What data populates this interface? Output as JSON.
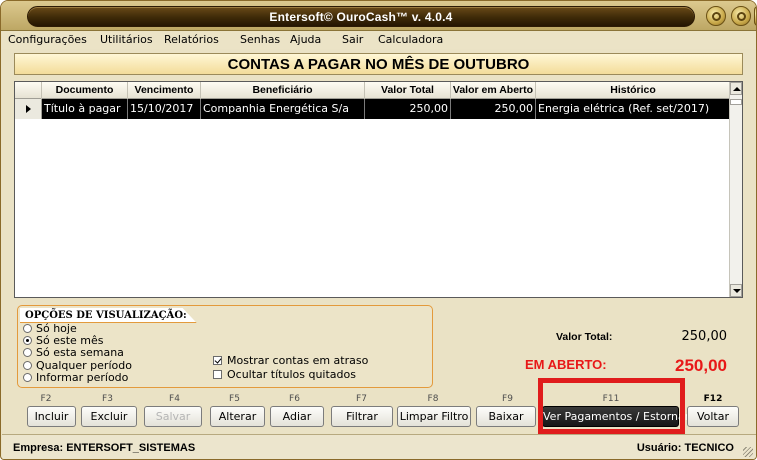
{
  "window": {
    "title": "Entersoft© OuroCash™ v. 4.0.4"
  },
  "menu": [
    "Configurações",
    "Utilitários",
    "Relatórios",
    "Senhas",
    "Ajuda",
    "Sair",
    "Calculadora"
  ],
  "page_title": "CONTAS A PAGAR NO MÊS DE OUTUBRO",
  "grid": {
    "columns": [
      "Documento",
      "Vencimento",
      "Beneficiário",
      "Valor Total",
      "Valor em Aberto",
      "Histórico"
    ],
    "rows": [
      {
        "documento": "Título à pagar",
        "vencimento": "15/10/2017",
        "beneficiario": "Companhia Energética S/a",
        "valor_total": "250,00",
        "valor_aberto": "250,00",
        "historico": "Energia elétrica (Ref. set/2017)"
      }
    ]
  },
  "options": {
    "title": "OPÇÕES DE VISUALIZAÇÃO:",
    "radios": [
      {
        "label": "Só hoje",
        "selected": false
      },
      {
        "label": "Só este mês",
        "selected": true
      },
      {
        "label": "Só esta semana",
        "selected": false
      },
      {
        "label": "Qualquer período",
        "selected": false
      },
      {
        "label": "Informar período",
        "selected": false
      }
    ],
    "checks": [
      {
        "label": "Mostrar contas em atraso",
        "checked": true
      },
      {
        "label": "Ocultar títulos quitados",
        "checked": false
      }
    ]
  },
  "totals": {
    "total_label": "Valor Total:",
    "total_value": "250,00",
    "open_label": "EM ABERTO:",
    "open_value": "250,00"
  },
  "buttons": [
    {
      "key": "F2",
      "label": "Incluir",
      "enabled": true
    },
    {
      "key": "F3",
      "label": "Excluir",
      "enabled": true
    },
    {
      "key": "F4",
      "label": "Salvar",
      "enabled": false
    },
    {
      "key": "F5",
      "label": "Alterar",
      "enabled": true
    },
    {
      "key": "F6",
      "label": "Adiar",
      "enabled": true
    },
    {
      "key": "F7",
      "label": "Filtrar",
      "enabled": true
    },
    {
      "key": "F8",
      "label": "Limpar Filtro",
      "enabled": true
    },
    {
      "key": "F9",
      "label": "Baixar",
      "enabled": true
    },
    {
      "key": "F11",
      "label": "Ver Pagamentos / Estornar",
      "enabled": true
    },
    {
      "key": "F12",
      "label": "Voltar",
      "enabled": true
    }
  ],
  "status": {
    "company": "Empresa: ENTERSOFT_SISTEMAS",
    "user": "Usuário: TECNICO"
  },
  "colors": {
    "accent_red": "#e81818",
    "titlebar": "#bda764",
    "selected_row": "#000000"
  }
}
